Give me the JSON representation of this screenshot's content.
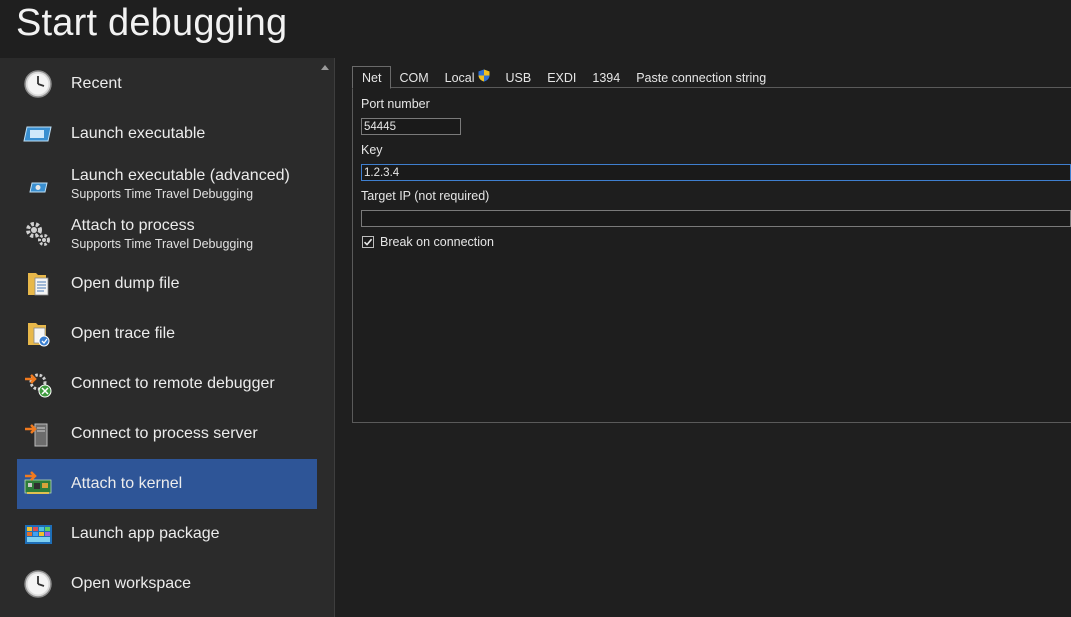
{
  "title": "Start debugging",
  "sidebar": {
    "items": [
      {
        "label": "Recent",
        "icon": "clock-icon"
      },
      {
        "label": "Launch executable",
        "icon": "executable-window-icon"
      },
      {
        "label": "Launch executable (advanced)",
        "sub": "Supports Time Travel Debugging",
        "icon": "executable-advanced-icon"
      },
      {
        "label": "Attach to process",
        "sub": "Supports Time Travel Debugging",
        "icon": "gears-icon"
      },
      {
        "label": "Open dump file",
        "icon": "dump-file-icon"
      },
      {
        "label": "Open trace file",
        "icon": "trace-file-icon"
      },
      {
        "label": "Connect to remote debugger",
        "icon": "remote-debugger-icon"
      },
      {
        "label": "Connect to process server",
        "icon": "process-server-icon"
      },
      {
        "label": "Attach to kernel",
        "icon": "kernel-card-icon",
        "selected": true
      },
      {
        "label": "Launch app package",
        "icon": "app-package-icon"
      },
      {
        "label": "Open workspace",
        "icon": "clock-icon"
      }
    ]
  },
  "tabs": [
    "Net",
    "COM",
    "Local",
    "USB",
    "EXDI",
    "1394",
    "Paste connection string"
  ],
  "active_tab": "Net",
  "form": {
    "port_label": "Port number",
    "port_value": "54445",
    "key_label": "Key",
    "key_value": "1.2.3.4",
    "target_label": "Target IP (not required)",
    "target_value": "",
    "break_label": "Break on connection",
    "break_checked": true
  },
  "colors": {
    "background": "#1f1f1f",
    "sidebar": "#2b2b2b",
    "selected": "#2e5597",
    "focus_border": "#3f7fcf"
  }
}
